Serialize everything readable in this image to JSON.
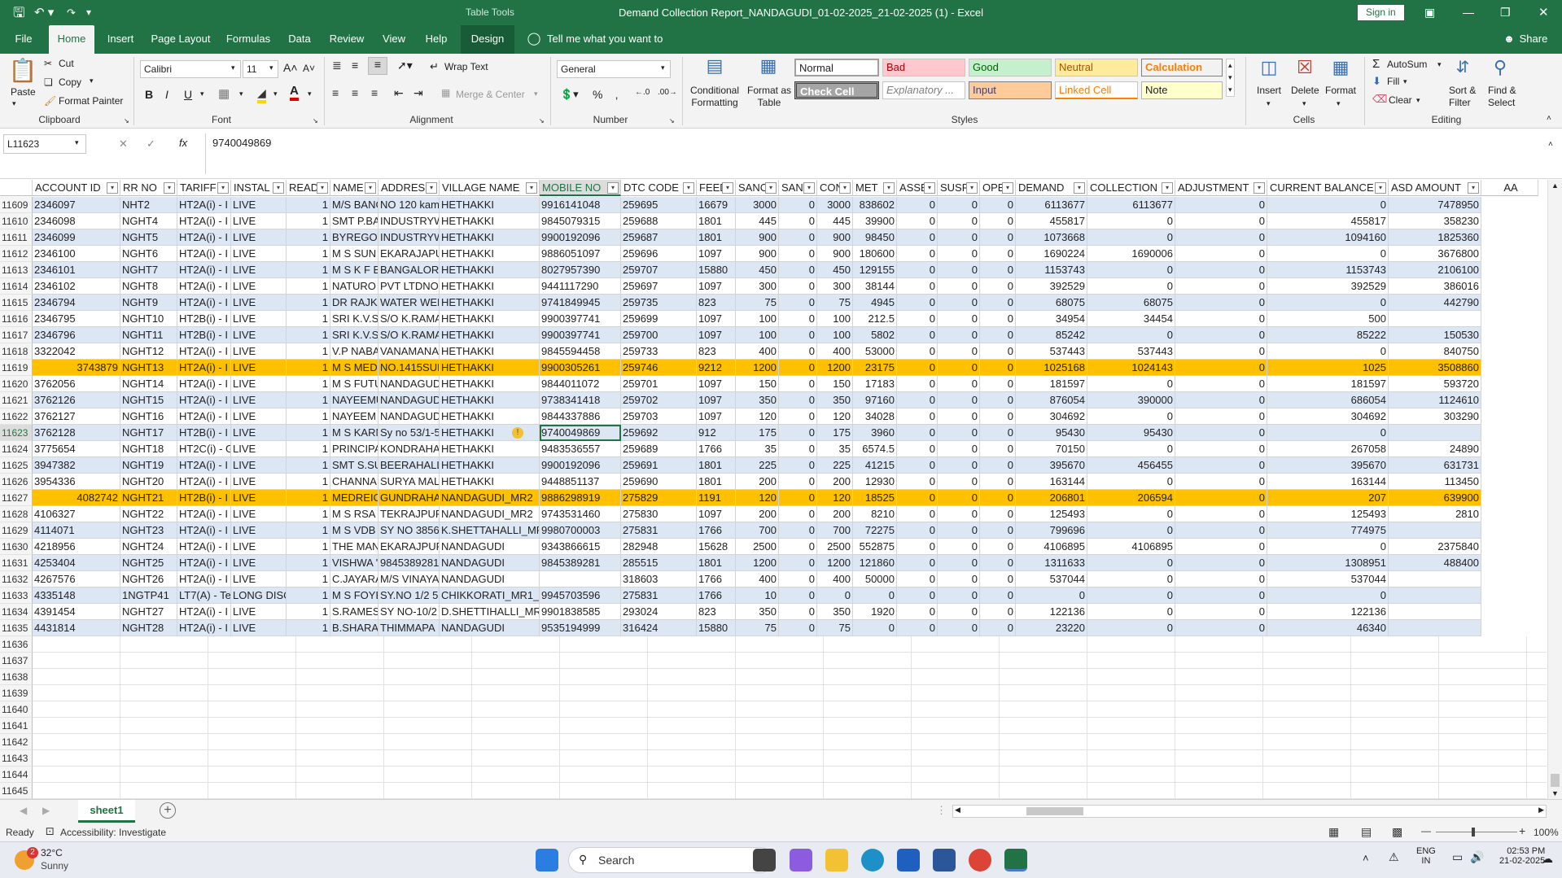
{
  "title": {
    "tools": "Table Tools",
    "doc": "Demand Collection Report_NANDAGUDI_01-02-2025_21-02-2025 (1)  -  Excel",
    "signin": "Sign in"
  },
  "tabs": [
    "File",
    "Home",
    "Insert",
    "Page Layout",
    "Formulas",
    "Data",
    "Review",
    "View",
    "Help",
    "Design"
  ],
  "tellme": "Tell me what you want to do",
  "share": "Share",
  "clipboard": {
    "paste": "Paste",
    "cut": "Cut",
    "copy": "Copy",
    "painter": "Format Painter",
    "label": "Clipboard"
  },
  "font": {
    "name": "Calibri",
    "size": "11",
    "label": "Font"
  },
  "alignment": {
    "wrap": "Wrap Text",
    "merge": "Merge & Center",
    "label": "Alignment"
  },
  "number": {
    "format": "General",
    "label": "Number"
  },
  "styles": {
    "cond": "Conditional Formatting",
    "fmt_table": "Format as Table",
    "normal": "Normal",
    "bad": "Bad",
    "good": "Good",
    "neutral": "Neutral",
    "calculation": "Calculation",
    "check": "Check Cell",
    "explanatory": "Explanatory ...",
    "input": "Input",
    "linked": "Linked Cell",
    "note": "Note",
    "label": "Styles"
  },
  "cells": {
    "insert": "Insert",
    "delete": "Delete",
    "format": "Format",
    "label": "Cells"
  },
  "editing": {
    "autosum": "AutoSum",
    "fill": "Fill",
    "clear": "Clear",
    "sort": "Sort & Filter",
    "find": "Find & Select",
    "label": "Editing"
  },
  "namebox": "L11623",
  "formula": "9740049869",
  "headers": [
    "ACCOUNT ID",
    "RR NO",
    "TARIFF",
    "INSTAL",
    "READ",
    "NAME",
    "ADDRESS",
    "VILLAGE NAME",
    "MOBILE NO",
    "DTC CODE",
    "FEED",
    "SANC",
    "SANC",
    "CON",
    "MET",
    "ASSE",
    "SUSP",
    "OPE",
    "DEMAND",
    "COLLECTION",
    "ADJUSTMENT",
    "CURRENT BALANCE",
    "ASD AMOUNT",
    "AA"
  ],
  "rows": [
    {
      "n": "11609",
      "d": [
        "2346097",
        "NHT2",
        "HT2A(i) - I",
        "LIVE",
        "1",
        "M/S BANG",
        "NO 120 kam",
        "HETHAKKI",
        "9916141048",
        "259695",
        "16679",
        "3000",
        "0",
        "3000",
        "838602",
        "0",
        "0",
        "0",
        "6113677",
        "6113677",
        "0",
        "0",
        "7478950"
      ]
    },
    {
      "n": "11610",
      "d": [
        "2346098",
        "NGHT4",
        "HT2A(i) - I",
        "LIVE",
        "1",
        "SMT P.BA",
        "INDUSTRYW",
        "HETHAKKI",
        "9845079315",
        "259688",
        "1801",
        "445",
        "0",
        "445",
        "39900",
        "0",
        "0",
        "0",
        "455817",
        "0",
        "0",
        "455817",
        "358230"
      ]
    },
    {
      "n": "11611",
      "d": [
        "2346099",
        "NGHT5",
        "HT2A(i) - I",
        "LIVE",
        "1",
        "BYREGOV",
        "INDUSTRYW",
        "HETHAKKI",
        "9900192096",
        "259687",
        "1801",
        "900",
        "0",
        "900",
        "98450",
        "0",
        "0",
        "0",
        "1073668",
        "0",
        "0",
        "1094160",
        "1825360"
      ]
    },
    {
      "n": "11612",
      "d": [
        "2346100",
        "NGHT6",
        "HT2A(i) - I",
        "LIVE",
        "1",
        "M S SUN I",
        "EKARAJAPU",
        "HETHAKKI",
        "9886051097",
        "259696",
        "1097",
        "900",
        "0",
        "900",
        "180600",
        "0",
        "0",
        "0",
        "1690224",
        "1690006",
        "0",
        "0",
        "3676800"
      ]
    },
    {
      "n": "11613",
      "d": [
        "2346101",
        "NGHT7",
        "HT2A(i) - I",
        "LIVE",
        "1",
        "M S K F BI",
        "BANGALORI",
        "HETHAKKI",
        "8027957390",
        "259707",
        "15880",
        "450",
        "0",
        "450",
        "129155",
        "0",
        "0",
        "0",
        "1153743",
        "0",
        "0",
        "1153743",
        "2106100"
      ]
    },
    {
      "n": "11614",
      "d": [
        "2346102",
        "NGHT8",
        "HT2A(i) - I",
        "LIVE",
        "1",
        "NATURO",
        "PVT LTDNO.",
        "HETHAKKI",
        "9441117290",
        "259697",
        "1097",
        "300",
        "0",
        "300",
        "38144",
        "0",
        "0",
        "0",
        "392529",
        "0",
        "0",
        "392529",
        "386016"
      ]
    },
    {
      "n": "11615",
      "d": [
        "2346794",
        "NGHT9",
        "HT2A(i) - I",
        "LIVE",
        "1",
        "DR RAJKU",
        "WATER WEE",
        "HETHAKKI",
        "9741849945",
        "259735",
        "823",
        "75",
        "0",
        "75",
        "4945",
        "0",
        "0",
        "0",
        "68075",
        "68075",
        "0",
        "0",
        "442790"
      ]
    },
    {
      "n": "11616",
      "d": [
        "2346795",
        "NGHT10",
        "HT2B(i) - I",
        "LIVE",
        "1",
        "SRI K.V.S.",
        "S/O K.RAMA",
        "HETHAKKI",
        "9900397741",
        "259699",
        "1097",
        "100",
        "0",
        "100",
        "212.5",
        "0",
        "0",
        "0",
        "34954",
        "34454",
        "0",
        "500",
        ""
      ]
    },
    {
      "n": "11617",
      "d": [
        "2346796",
        "NGHT11",
        "HT2B(i) - I",
        "LIVE",
        "1",
        "SRI K.V.S.",
        "S/O K.RAMA",
        "HETHAKKI",
        "9900397741",
        "259700",
        "1097",
        "100",
        "0",
        "100",
        "5802",
        "0",
        "0",
        "0",
        "85242",
        "0",
        "0",
        "85222",
        "150530"
      ]
    },
    {
      "n": "11618",
      "d": [
        "3322042",
        "NGHT12",
        "HT2A(i) - I",
        "LIVE",
        "1",
        "V.P NABA",
        "VANAMANA",
        "HETHAKKI",
        "9845594458",
        "259733",
        "823",
        "400",
        "0",
        "400",
        "53000",
        "0",
        "0",
        "0",
        "537443",
        "537443",
        "0",
        "0",
        "840750"
      ]
    },
    {
      "n": "11619",
      "d": [
        "3743879",
        "NGHT13",
        "HT2A(i) - I",
        "LIVE",
        "1",
        "M S MEDI",
        "NO.1415SUL",
        "HETHAKKI",
        "9900305261",
        "259746",
        "9212",
        "1200",
        "0",
        "1200",
        "23175",
        "0",
        "0",
        "0",
        "1025168",
        "1024143",
        "0",
        "1025",
        "3508860"
      ]
    },
    {
      "n": "11620",
      "d": [
        "3762056",
        "NGHT14",
        "HT2A(i) - I",
        "LIVE",
        "1",
        "M S FUTU",
        "NANDAGUD",
        "HETHAKKI",
        "9844011072",
        "259701",
        "1097",
        "150",
        "0",
        "150",
        "17183",
        "0",
        "0",
        "0",
        "181597",
        "0",
        "0",
        "181597",
        "593720"
      ]
    },
    {
      "n": "11621",
      "d": [
        "3762126",
        "NGHT15",
        "HT2A(i) - I",
        "LIVE",
        "1",
        "NAYEEMU",
        "NANDAGUD",
        "HETHAKKI",
        "9738341418",
        "259702",
        "1097",
        "350",
        "0",
        "350",
        "97160",
        "0",
        "0",
        "0",
        "876054",
        "390000",
        "0",
        "686054",
        "1124610"
      ]
    },
    {
      "n": "11622",
      "d": [
        "3762127",
        "NGHT16",
        "HT2A(i) - I",
        "LIVE",
        "1",
        "NAYEEM I",
        "NANDAGUD",
        "HETHAKKI",
        "9844337886",
        "259703",
        "1097",
        "120",
        "0",
        "120",
        "34028",
        "0",
        "0",
        "0",
        "304692",
        "0",
        "0",
        "304692",
        "303290"
      ]
    },
    {
      "n": "11623",
      "d": [
        "3762128",
        "NGHT17",
        "HT2B(i) - I",
        "LIVE",
        "1",
        "M S KARN",
        "Sy no 53/1-5",
        "HETHAKKI",
        "9740049869",
        "259692",
        "912",
        "175",
        "0",
        "175",
        "3960",
        "0",
        "0",
        "0",
        "95430",
        "95430",
        "0",
        "0",
        ""
      ]
    },
    {
      "n": "11624",
      "d": [
        "3775654",
        "NGHT18",
        "HT2C(i) - G",
        "LIVE",
        "1",
        "PRINCIPA",
        "KONDRAHA",
        "HETHAKKI",
        "9483536557",
        "259689",
        "1766",
        "35",
        "0",
        "35",
        "6574.5",
        "0",
        "0",
        "0",
        "70150",
        "0",
        "0",
        "267058",
        "24890"
      ]
    },
    {
      "n": "11625",
      "d": [
        "3947382",
        "NGHT19",
        "HT2A(i) - I",
        "LIVE",
        "1",
        "SMT S.SU",
        "BEERAHALLI",
        "HETHAKKI",
        "9900192096",
        "259691",
        "1801",
        "225",
        "0",
        "225",
        "41215",
        "0",
        "0",
        "0",
        "395670",
        "456455",
        "0",
        "395670",
        "631731"
      ]
    },
    {
      "n": "11626",
      "d": [
        "3954336",
        "NGHT20",
        "HT2A(i) - I",
        "LIVE",
        "1",
        "CHANNAI",
        "SURYA MAL",
        "HETHAKKI",
        "9448851137",
        "259690",
        "1801",
        "200",
        "0",
        "200",
        "12930",
        "0",
        "0",
        "0",
        "163144",
        "0",
        "0",
        "163144",
        "113450"
      ]
    },
    {
      "n": "11627",
      "d": [
        "4082742",
        "NGHT21",
        "HT2B(i) - I",
        "LIVE",
        "1",
        "MEDREIC",
        "GUNDRAHA",
        "NANDAGUDI_MR2",
        "9886298919",
        "275829",
        "1191",
        "120",
        "0",
        "120",
        "18525",
        "0",
        "0",
        "0",
        "206801",
        "206594",
        "0",
        "207",
        "639900"
      ]
    },
    {
      "n": "11628",
      "d": [
        "4106327",
        "NGHT22",
        "HT2A(i) - I",
        "LIVE",
        "1",
        "M S RSA T",
        "TEKRAJPURA",
        "NANDAGUDI_MR2",
        "9743531460",
        "275830",
        "1097",
        "200",
        "0",
        "200",
        "8210",
        "0",
        "0",
        "0",
        "125493",
        "0",
        "0",
        "125493",
        "2810"
      ]
    },
    {
      "n": "11629",
      "d": [
        "4114071",
        "NGHT23",
        "HT2A(i) - I",
        "LIVE",
        "1",
        "M S VDB I",
        "SY NO 38568",
        "K.SHETTAHALLI_MR",
        "9980700003",
        "275831",
        "1766",
        "700",
        "0",
        "700",
        "72275",
        "0",
        "0",
        "0",
        "799696",
        "0",
        "0",
        "774975",
        ""
      ]
    },
    {
      "n": "11630",
      "d": [
        "4218956",
        "NGHT24",
        "HT2A(i) - I",
        "LIVE",
        "1",
        "THE MAN",
        "EKARAJPUR",
        "NANDAGUDI",
        "9343866615",
        "282948",
        "15628",
        "2500",
        "0",
        "2500",
        "552875",
        "0",
        "0",
        "0",
        "4106895",
        "4106895",
        "0",
        "0",
        "2375840"
      ]
    },
    {
      "n": "11631",
      "d": [
        "4253404",
        "NGHT25",
        "HT2A(i) - I",
        "LIVE",
        "1",
        "VISHWA '",
        "9845389281",
        "NANDAGUDI",
        "9845389281",
        "285515",
        "1801",
        "1200",
        "0",
        "1200",
        "121860",
        "0",
        "0",
        "0",
        "1311633",
        "0",
        "0",
        "1308951",
        "488400"
      ]
    },
    {
      "n": "11632",
      "d": [
        "4267576",
        "NGHT26",
        "HT2A(i) - I",
        "LIVE",
        "1",
        "C.JAYARA",
        "M/S VINAYA",
        "NANDAGUDI",
        "",
        "318603",
        "1766",
        "400",
        "0",
        "400",
        "50000",
        "0",
        "0",
        "0",
        "537044",
        "0",
        "0",
        "537044",
        ""
      ]
    },
    {
      "n": "11633",
      "d": [
        "4335148",
        "1NGTP41",
        "LT7(A) - Te",
        "LONG DISC",
        "1",
        "M S FOYE",
        "SY.NO 1/2 5",
        "CHIKKORATI_MR1_I",
        "9945703596",
        "275831",
        "1766",
        "10",
        "0",
        "0",
        "0",
        "0",
        "0",
        "0",
        "0",
        "0",
        "0",
        "0",
        ""
      ]
    },
    {
      "n": "11634",
      "d": [
        "4391454",
        "NGHT27",
        "HT2A(i) - I",
        "LIVE",
        "1",
        "S.RAMESI",
        "SY NO-10/2",
        "D.SHETTIHALLI_MR",
        "9901838585",
        "293024",
        "823",
        "350",
        "0",
        "350",
        "1920",
        "0",
        "0",
        "0",
        "122136",
        "0",
        "0",
        "122136",
        ""
      ]
    },
    {
      "n": "11635",
      "d": [
        "4431814",
        "NGHT28",
        "HT2A(i) - I",
        "LIVE",
        "1",
        "B.SHARAT",
        "THIMMAPA",
        "NANDAGUDI",
        "9535194999",
        "316424",
        "15880",
        "75",
        "0",
        "75",
        "0",
        "0",
        "0",
        "0",
        "23220",
        "0",
        "0",
        "46340",
        ""
      ]
    }
  ],
  "empty_rows": [
    "11636",
    "11637",
    "11638",
    "11639",
    "11640",
    "11641",
    "11642",
    "11643",
    "11644",
    "11645"
  ],
  "sheet": "sheet1",
  "status": {
    "ready": "Ready",
    "access": "Accessibility: Investigate",
    "zoom": "100%"
  },
  "taskbar": {
    "temp": "32°C",
    "weather": "Sunny",
    "badge": "2",
    "search": "Search",
    "lang1": "ENG",
    "lang2": "IN",
    "time": "02:53 PM",
    "date": "21-02-2025"
  }
}
